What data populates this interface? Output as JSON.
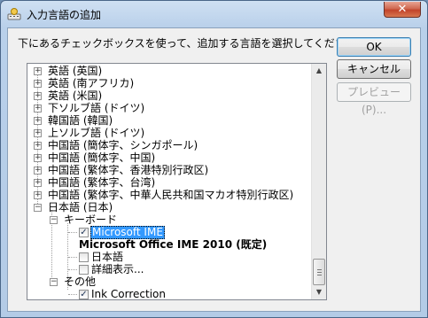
{
  "window": {
    "title": "入力言語の追加",
    "close_symbol": "✕"
  },
  "dialog": {
    "instruction": "下にあるチェックボックスを使って、追加する言語を選択してください。"
  },
  "buttons": {
    "ok": "OK",
    "cancel": "キャンセル",
    "preview": "プレビュー(P)..."
  },
  "tree": {
    "languages": [
      "英語 (英国)",
      "英語 (南アフリカ)",
      "英語 (米国)",
      "下ソルブ語 (ドイツ)",
      "韓国語 (韓国)",
      "上ソルブ語 (ドイツ)",
      "中国語 (簡体字、シンガポール)",
      "中国語 (簡体字、中国)",
      "中国語 (繁体字、香港特別行政区)",
      "中国語 (繁体字、台湾)",
      "中国語 (繁体字、中華人民共和国マカオ特別行政区)",
      "日本語 (日本)"
    ],
    "keyboard_group": "キーボード",
    "keyboard_items": [
      "Microsoft IME",
      "Microsoft Office IME 2010 (既定)",
      "日本語",
      "詳細表示..."
    ],
    "other_group": "その他",
    "other_items": [
      "Ink Correction"
    ]
  }
}
